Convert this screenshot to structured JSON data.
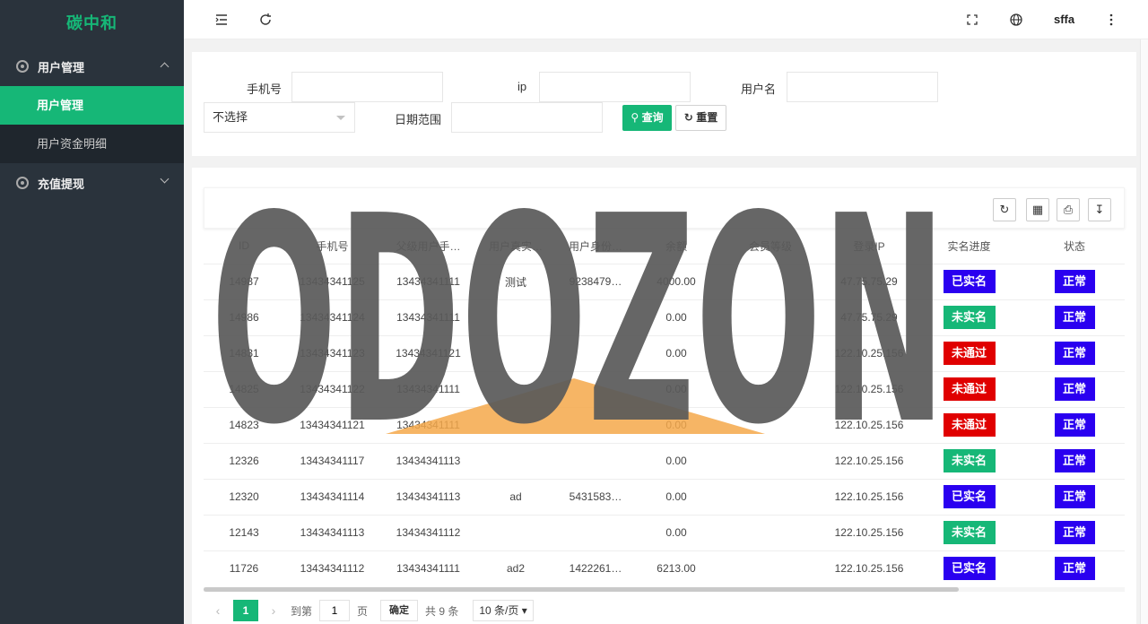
{
  "sidebar": {
    "logo": "碳中和",
    "groups": [
      {
        "label": "用户管理",
        "expanded": true,
        "items": [
          {
            "label": "用户管理",
            "active": true
          },
          {
            "label": "用户资金明细",
            "active": false
          }
        ]
      },
      {
        "label": "充值提现",
        "expanded": false
      }
    ]
  },
  "header": {
    "icons": [
      "menu-fold-icon",
      "refresh-icon",
      "fullscreen-icon",
      "globe-icon",
      "more-vertical-icon"
    ],
    "username": "sffa"
  },
  "search": {
    "phone_label": "手机号",
    "phone_value": "",
    "ip_label": "ip",
    "ip_value": "",
    "username_label": "用户名",
    "username_value": "",
    "select_value": "不选择",
    "date_label": "日期范围",
    "date_value": "",
    "query_label": "查询",
    "reset_label": "重置"
  },
  "toolbar": {
    "icons": [
      "refresh-icon",
      "columns-icon",
      "print-icon",
      "export-icon"
    ]
  },
  "table": {
    "columns": [
      "ID",
      "手机号",
      "父级用户手…",
      "用户真实…",
      "用户身份…",
      "余额",
      "会员等级",
      "登录IP",
      "实名进度",
      "状态"
    ],
    "rows": [
      {
        "id": "14987",
        "phone": "13434341125",
        "parent": "13434341111",
        "realname": "测试",
        "idcard": "9238479…",
        "balance": "4000.00",
        "level": "",
        "ip": "47.75.75.29",
        "verify": "已实名",
        "verify_color": "#2a00f0",
        "status": "正常"
      },
      {
        "id": "14986",
        "phone": "13434341124",
        "parent": "13434341111",
        "realname": "",
        "idcard": "",
        "balance": "0.00",
        "level": "",
        "ip": "47.75.75.29",
        "verify": "未实名",
        "verify_color": "#16b777",
        "status": "正常"
      },
      {
        "id": "14831",
        "phone": "13434341123",
        "parent": "13434341121",
        "realname": "",
        "idcard": "",
        "balance": "0.00",
        "level": "",
        "ip": "122.10.25.156",
        "verify": "未通过",
        "verify_color": "#e00000",
        "status": "正常"
      },
      {
        "id": "14825",
        "phone": "13434341122",
        "parent": "13434341111",
        "realname": "",
        "idcard": "",
        "balance": "0.00",
        "level": "",
        "ip": "122.10.25.156",
        "verify": "未通过",
        "verify_color": "#e00000",
        "status": "正常"
      },
      {
        "id": "14823",
        "phone": "13434341121",
        "parent": "13434341111",
        "realname": "",
        "idcard": "",
        "balance": "0.00",
        "level": "",
        "ip": "122.10.25.156",
        "verify": "未通过",
        "verify_color": "#e00000",
        "status": "正常"
      },
      {
        "id": "12326",
        "phone": "13434341117",
        "parent": "13434341113",
        "realname": "",
        "idcard": "",
        "balance": "0.00",
        "level": "",
        "ip": "122.10.25.156",
        "verify": "未实名",
        "verify_color": "#16b777",
        "status": "正常"
      },
      {
        "id": "12320",
        "phone": "13434341114",
        "parent": "13434341113",
        "realname": "ad",
        "idcard": "5431583…",
        "balance": "0.00",
        "level": "",
        "ip": "122.10.25.156",
        "verify": "已实名",
        "verify_color": "#2a00f0",
        "status": "正常"
      },
      {
        "id": "12143",
        "phone": "13434341113",
        "parent": "13434341112",
        "realname": "",
        "idcard": "",
        "balance": "0.00",
        "level": "",
        "ip": "122.10.25.156",
        "verify": "未实名",
        "verify_color": "#16b777",
        "status": "正常"
      },
      {
        "id": "11726",
        "phone": "13434341112",
        "parent": "13434341111",
        "realname": "ad2",
        "idcard": "1422261…",
        "balance": "6213.00",
        "level": "",
        "ip": "122.10.25.156",
        "verify": "已实名",
        "verify_color": "#2a00f0",
        "status": "正常"
      }
    ]
  },
  "pager": {
    "current_page": "1",
    "goto_label": "到第",
    "goto_value": "1",
    "page_unit": "页",
    "confirm_label": "确定",
    "total_label": "共 9 条",
    "page_size": "10 条/页"
  },
  "watermark": {
    "text": "ODOZON",
    "color": "#5a5a5a",
    "accent": "#f5a84a"
  }
}
